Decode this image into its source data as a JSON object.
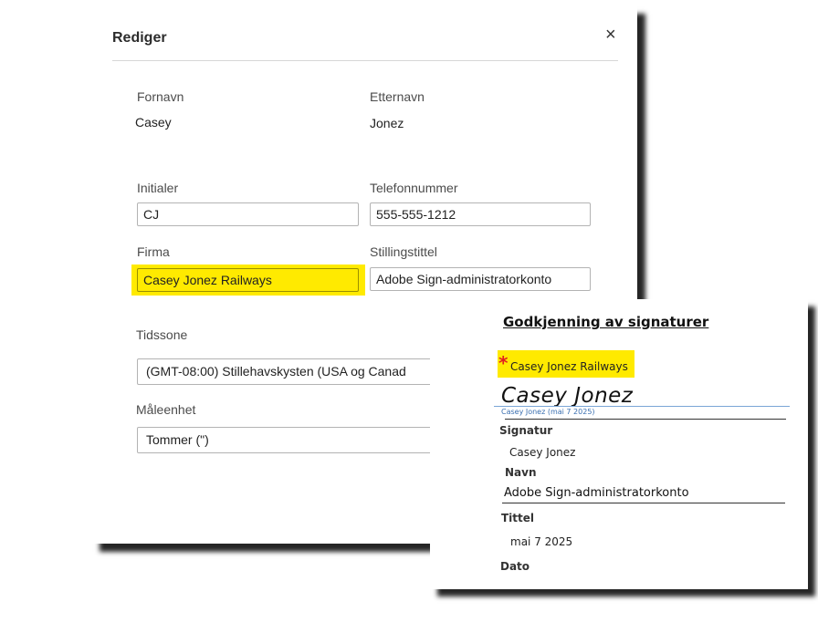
{
  "dialog": {
    "title": "Rediger",
    "close_icon": "×",
    "first_name_label": "Fornavn",
    "first_name_value": "Casey",
    "last_name_label": "Etternavn",
    "last_name_value": "Jonez",
    "initials_label": "Initialer",
    "initials_value": "CJ",
    "phone_label": "Telefonnummer",
    "phone_value": "555-555-1212",
    "company_label": "Firma",
    "company_value": "Casey Jonez Railways",
    "job_title_label": "Stillingstittel",
    "job_title_value": "Adobe Sign-administratorkonto",
    "timezone_label": "Tidssone",
    "timezone_value": "(GMT-08:00) Stillehavskysten (USA og Canad",
    "unit_label": "Måleenhet",
    "unit_value": "Tommer (\")"
  },
  "signature_card": {
    "title": "Godkjenning av signaturer",
    "required_marker": "*",
    "company_value": "Casey Jonez Railways",
    "signature_script": "Casey Jonez",
    "signature_caption": "Casey Jonez (mai 7 2025)",
    "signature_label": "Signatur",
    "name_value": "Casey Jonez",
    "name_label": "Navn",
    "title_value": "Adobe Sign-administratorkonto",
    "title_label": "Tittel",
    "date_value": "mai 7 2025",
    "date_label": "Dato"
  },
  "colors": {
    "highlight": "#ffea00",
    "required": "#e02020",
    "caption_blue": "#3a6fb0"
  }
}
